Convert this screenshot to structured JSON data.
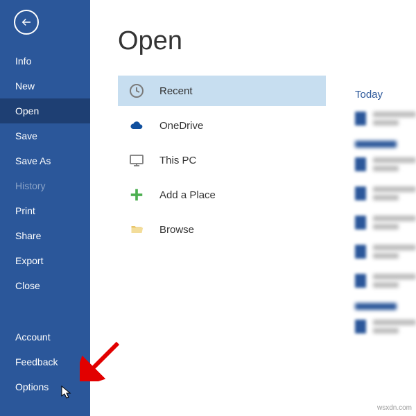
{
  "sidebar": {
    "items": [
      {
        "label": "Info"
      },
      {
        "label": "New"
      },
      {
        "label": "Open"
      },
      {
        "label": "Save"
      },
      {
        "label": "Save As"
      },
      {
        "label": "History"
      },
      {
        "label": "Print"
      },
      {
        "label": "Share"
      },
      {
        "label": "Export"
      },
      {
        "label": "Close"
      },
      {
        "label": "Account"
      },
      {
        "label": "Feedback"
      },
      {
        "label": "Options"
      }
    ]
  },
  "page": {
    "title": "Open"
  },
  "locations": {
    "recent": "Recent",
    "onedrive": "OneDrive",
    "thispc": "This PC",
    "addplace": "Add a Place",
    "browse": "Browse"
  },
  "rightPanel": {
    "today": "Today"
  },
  "watermark": "wsxdn.com"
}
